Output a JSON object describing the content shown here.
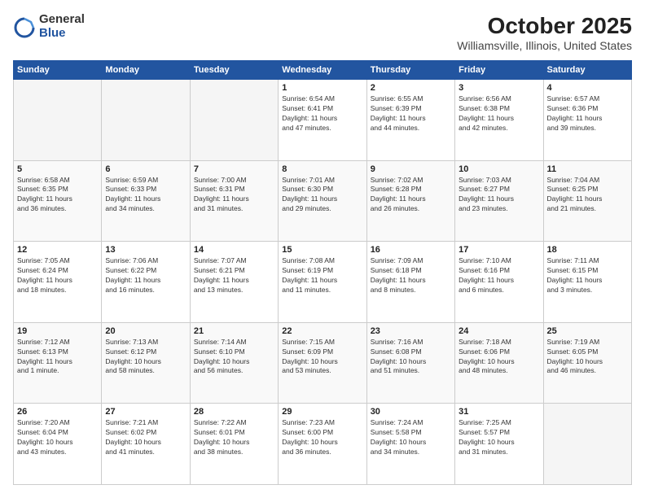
{
  "logo": {
    "general": "General",
    "blue": "Blue"
  },
  "header": {
    "month": "October 2025",
    "location": "Williamsville, Illinois, United States"
  },
  "weekdays": [
    "Sunday",
    "Monday",
    "Tuesday",
    "Wednesday",
    "Thursday",
    "Friday",
    "Saturday"
  ],
  "weeks": [
    [
      {
        "day": "",
        "info": ""
      },
      {
        "day": "",
        "info": ""
      },
      {
        "day": "",
        "info": ""
      },
      {
        "day": "1",
        "info": "Sunrise: 6:54 AM\nSunset: 6:41 PM\nDaylight: 11 hours\nand 47 minutes."
      },
      {
        "day": "2",
        "info": "Sunrise: 6:55 AM\nSunset: 6:39 PM\nDaylight: 11 hours\nand 44 minutes."
      },
      {
        "day": "3",
        "info": "Sunrise: 6:56 AM\nSunset: 6:38 PM\nDaylight: 11 hours\nand 42 minutes."
      },
      {
        "day": "4",
        "info": "Sunrise: 6:57 AM\nSunset: 6:36 PM\nDaylight: 11 hours\nand 39 minutes."
      }
    ],
    [
      {
        "day": "5",
        "info": "Sunrise: 6:58 AM\nSunset: 6:35 PM\nDaylight: 11 hours\nand 36 minutes."
      },
      {
        "day": "6",
        "info": "Sunrise: 6:59 AM\nSunset: 6:33 PM\nDaylight: 11 hours\nand 34 minutes."
      },
      {
        "day": "7",
        "info": "Sunrise: 7:00 AM\nSunset: 6:31 PM\nDaylight: 11 hours\nand 31 minutes."
      },
      {
        "day": "8",
        "info": "Sunrise: 7:01 AM\nSunset: 6:30 PM\nDaylight: 11 hours\nand 29 minutes."
      },
      {
        "day": "9",
        "info": "Sunrise: 7:02 AM\nSunset: 6:28 PM\nDaylight: 11 hours\nand 26 minutes."
      },
      {
        "day": "10",
        "info": "Sunrise: 7:03 AM\nSunset: 6:27 PM\nDaylight: 11 hours\nand 23 minutes."
      },
      {
        "day": "11",
        "info": "Sunrise: 7:04 AM\nSunset: 6:25 PM\nDaylight: 11 hours\nand 21 minutes."
      }
    ],
    [
      {
        "day": "12",
        "info": "Sunrise: 7:05 AM\nSunset: 6:24 PM\nDaylight: 11 hours\nand 18 minutes."
      },
      {
        "day": "13",
        "info": "Sunrise: 7:06 AM\nSunset: 6:22 PM\nDaylight: 11 hours\nand 16 minutes."
      },
      {
        "day": "14",
        "info": "Sunrise: 7:07 AM\nSunset: 6:21 PM\nDaylight: 11 hours\nand 13 minutes."
      },
      {
        "day": "15",
        "info": "Sunrise: 7:08 AM\nSunset: 6:19 PM\nDaylight: 11 hours\nand 11 minutes."
      },
      {
        "day": "16",
        "info": "Sunrise: 7:09 AM\nSunset: 6:18 PM\nDaylight: 11 hours\nand 8 minutes."
      },
      {
        "day": "17",
        "info": "Sunrise: 7:10 AM\nSunset: 6:16 PM\nDaylight: 11 hours\nand 6 minutes."
      },
      {
        "day": "18",
        "info": "Sunrise: 7:11 AM\nSunset: 6:15 PM\nDaylight: 11 hours\nand 3 minutes."
      }
    ],
    [
      {
        "day": "19",
        "info": "Sunrise: 7:12 AM\nSunset: 6:13 PM\nDaylight: 11 hours\nand 1 minute."
      },
      {
        "day": "20",
        "info": "Sunrise: 7:13 AM\nSunset: 6:12 PM\nDaylight: 10 hours\nand 58 minutes."
      },
      {
        "day": "21",
        "info": "Sunrise: 7:14 AM\nSunset: 6:10 PM\nDaylight: 10 hours\nand 56 minutes."
      },
      {
        "day": "22",
        "info": "Sunrise: 7:15 AM\nSunset: 6:09 PM\nDaylight: 10 hours\nand 53 minutes."
      },
      {
        "day": "23",
        "info": "Sunrise: 7:16 AM\nSunset: 6:08 PM\nDaylight: 10 hours\nand 51 minutes."
      },
      {
        "day": "24",
        "info": "Sunrise: 7:18 AM\nSunset: 6:06 PM\nDaylight: 10 hours\nand 48 minutes."
      },
      {
        "day": "25",
        "info": "Sunrise: 7:19 AM\nSunset: 6:05 PM\nDaylight: 10 hours\nand 46 minutes."
      }
    ],
    [
      {
        "day": "26",
        "info": "Sunrise: 7:20 AM\nSunset: 6:04 PM\nDaylight: 10 hours\nand 43 minutes."
      },
      {
        "day": "27",
        "info": "Sunrise: 7:21 AM\nSunset: 6:02 PM\nDaylight: 10 hours\nand 41 minutes."
      },
      {
        "day": "28",
        "info": "Sunrise: 7:22 AM\nSunset: 6:01 PM\nDaylight: 10 hours\nand 38 minutes."
      },
      {
        "day": "29",
        "info": "Sunrise: 7:23 AM\nSunset: 6:00 PM\nDaylight: 10 hours\nand 36 minutes."
      },
      {
        "day": "30",
        "info": "Sunrise: 7:24 AM\nSunset: 5:58 PM\nDaylight: 10 hours\nand 34 minutes."
      },
      {
        "day": "31",
        "info": "Sunrise: 7:25 AM\nSunset: 5:57 PM\nDaylight: 10 hours\nand 31 minutes."
      },
      {
        "day": "",
        "info": ""
      }
    ]
  ]
}
